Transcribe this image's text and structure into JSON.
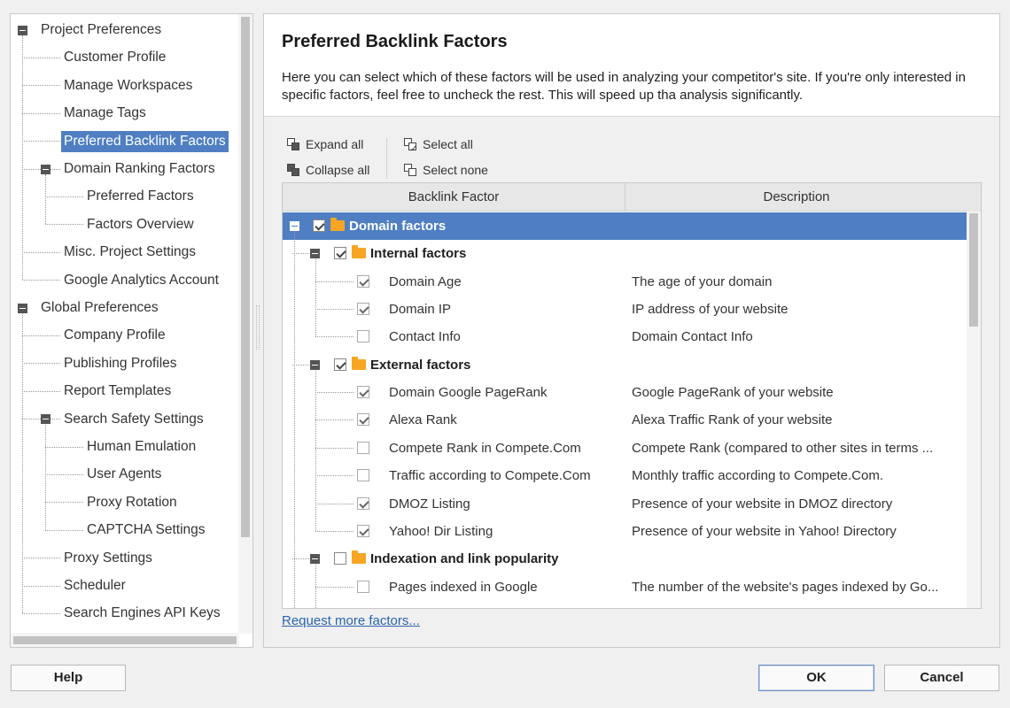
{
  "nav_tree": [
    {
      "label": "Project Preferences",
      "level": 0,
      "expander": true
    },
    {
      "label": "Customer Profile",
      "level": 1
    },
    {
      "label": "Manage Workspaces",
      "level": 1
    },
    {
      "label": "Manage Tags",
      "level": 1
    },
    {
      "label": "Preferred Backlink Factors",
      "level": 1,
      "selected": true
    },
    {
      "label": "Domain Ranking Factors",
      "level": 1,
      "expander": true
    },
    {
      "label": "Preferred Factors",
      "level": 2
    },
    {
      "label": "Factors Overview",
      "level": 2
    },
    {
      "label": "Misc. Project Settings",
      "level": 1
    },
    {
      "label": "Google Analytics Account",
      "level": 1
    },
    {
      "label": "Global Preferences",
      "level": 0,
      "expander": true
    },
    {
      "label": "Company Profile",
      "level": 1
    },
    {
      "label": "Publishing Profiles",
      "level": 1
    },
    {
      "label": "Report Templates",
      "level": 1
    },
    {
      "label": "Search Safety Settings",
      "level": 1,
      "expander": true
    },
    {
      "label": "Human Emulation",
      "level": 2
    },
    {
      "label": "User Agents",
      "level": 2
    },
    {
      "label": "Proxy Rotation",
      "level": 2
    },
    {
      "label": "CAPTCHA Settings",
      "level": 2
    },
    {
      "label": "Proxy Settings",
      "level": 1
    },
    {
      "label": "Scheduler",
      "level": 1
    },
    {
      "label": "Search Engines API Keys",
      "level": 1
    }
  ],
  "header": {
    "title": "Preferred Backlink Factors",
    "description": "Here you can select which of these factors will be used in analyzing your competitor's site. If you're only interested in specific factors, feel free to uncheck the rest. This will speed up tha analysis significantly."
  },
  "toolbar": {
    "expand_all": "Expand all",
    "collapse_all": "Collapse all",
    "select_all": "Select all",
    "select_none": "Select none"
  },
  "grid": {
    "columns": [
      "Backlink Factor",
      "Description"
    ],
    "rows": [
      {
        "type": "group",
        "level": 0,
        "name": "Domain factors",
        "checked": true,
        "selected": true
      },
      {
        "type": "group",
        "level": 1,
        "name": "Internal factors",
        "checked": true
      },
      {
        "type": "item",
        "level": 2,
        "name": "Domain Age",
        "description": "The age of your domain",
        "checked": true
      },
      {
        "type": "item",
        "level": 2,
        "name": "Domain IP",
        "description": "IP address of your website",
        "checked": true
      },
      {
        "type": "item",
        "level": 2,
        "name": "Contact Info",
        "description": "Domain Contact Info",
        "checked": false
      },
      {
        "type": "group",
        "level": 1,
        "name": "External factors",
        "checked": true
      },
      {
        "type": "item",
        "level": 2,
        "name": "Domain Google PageRank",
        "description": "Google PageRank of your website",
        "checked": true
      },
      {
        "type": "item",
        "level": 2,
        "name": "Alexa Rank",
        "description": "Alexa Traffic Rank of your website",
        "checked": true
      },
      {
        "type": "item",
        "level": 2,
        "name": "Compete Rank in Compete.Com",
        "description": "Compete Rank (compared to other sites in terms ...",
        "checked": false
      },
      {
        "type": "item",
        "level": 2,
        "name": "Traffic according to Compete.Com",
        "description": "Monthly traffic according to Compete.Com.",
        "checked": false
      },
      {
        "type": "item",
        "level": 2,
        "name": "DMOZ Listing",
        "description": "Presence of your website in DMOZ directory",
        "checked": true
      },
      {
        "type": "item",
        "level": 2,
        "name": "Yahoo! Dir Listing",
        "description": "Presence of your website in Yahoo! Directory",
        "checked": true
      },
      {
        "type": "group",
        "level": 1,
        "name": "Indexation and link popularity",
        "checked": false
      },
      {
        "type": "item",
        "level": 2,
        "name": "Pages indexed in Google",
        "description": "The number of the website's pages indexed by Go...",
        "checked": false
      }
    ]
  },
  "request_link": "Request more factors...",
  "buttons": {
    "help": "Help",
    "ok": "OK",
    "cancel": "Cancel"
  },
  "colors": {
    "selection": "#4f7fc2",
    "folder": "#f6a623",
    "link": "#2a64b0"
  }
}
